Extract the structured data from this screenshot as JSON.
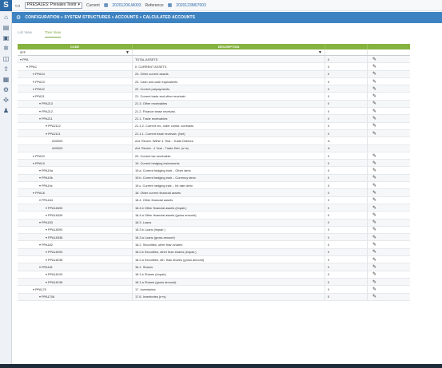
{
  "rail": {
    "logo": "S",
    "icons": [
      "home-icon",
      "document-icon",
      "folder-icon",
      "settings-icon",
      "report-icon",
      "upload-icon",
      "calendar-icon",
      "gear-icon",
      "tools-icon",
      "users-icon"
    ]
  },
  "topbar": {
    "scenario": "PRESALES: Presales Testir",
    "current_label": "Current",
    "current_value": "2020120/UA003",
    "reference_label": "Reference",
    "reference_value": "2020123M07003"
  },
  "title": "CONFIGURATION » SYSTEM STRUCTURES » ACCOUNTS » CALCULATED ACCOUNTS",
  "tabs": [
    {
      "label": "List View",
      "active": false
    },
    {
      "label": "Tree View",
      "active": true
    }
  ],
  "grid": {
    "headers": {
      "code": "CODE",
      "description": "DESCRIPTION"
    },
    "filter": {
      "code": "0PF",
      "description": ""
    },
    "rows": [
      {
        "indent": 0,
        "code": "PPA",
        "desc": "TOTAL ASSETS",
        "num": "0",
        "edit": true
      },
      {
        "indent": 1,
        "code": "PPAC",
        "desc": "II. CURRENT ASSETS",
        "num": "0",
        "edit": true
      },
      {
        "indent": 2,
        "code": "PPA24",
        "desc": "24. Other current assets",
        "num": "0",
        "edit": true
      },
      {
        "indent": 2,
        "code": "PPA23",
        "desc": "23. Cash and cash equivalents",
        "num": "0",
        "edit": true
      },
      {
        "indent": 2,
        "code": "PPA22",
        "desc": "22. Current prepayments",
        "num": "0",
        "edit": true
      },
      {
        "indent": 2,
        "code": "PPA21",
        "desc": "21. Current trade and other receivab.",
        "num": "0",
        "edit": true
      },
      {
        "indent": 3,
        "code": "PPA213",
        "desc": "21.3. Other receivables",
        "num": "0",
        "edit": true
      },
      {
        "indent": 3,
        "code": "PPA212",
        "desc": "21.2. Finance lease receivab.",
        "num": "0",
        "edit": true
      },
      {
        "indent": 3,
        "code": "PPA211",
        "desc": "21.1. Trade receivables",
        "num": "0",
        "edit": true
      },
      {
        "indent": 4,
        "code": "PPA2112",
        "desc": "21.1.2. Current rec. order constr. contracts",
        "num": "0",
        "edit": true
      },
      {
        "indent": 4,
        "code": "PPA2111",
        "desc": "21.1.1. Current trade receivab. (Net)",
        "num": "0",
        "edit": true
      },
      {
        "indent": 5,
        "code": "A00000",
        "desc": "Ant. Receiv. Within 1 Year - Trade Debtors",
        "num": "A",
        "edit": false
      },
      {
        "indent": 5,
        "code": "A00000",
        "desc": "Ant. Receiv. -1 Year - Trade Deb. (s+a)",
        "num": "A",
        "edit": false
      },
      {
        "indent": 2,
        "code": "PPA20",
        "desc": "20. Current tax receivable",
        "num": "0",
        "edit": true
      },
      {
        "indent": 2,
        "code": "PPA19",
        "desc": "19. Current hedging instruments",
        "num": "0",
        "edit": true
      },
      {
        "indent": 3,
        "code": "PPA19a",
        "desc": "19.a. Current hedging instr. - Other deriv.",
        "num": "0",
        "edit": true
      },
      {
        "indent": 3,
        "code": "PPA19b",
        "desc": "19.b. Current hedging instr. - Currency deriv.",
        "num": "0",
        "edit": true
      },
      {
        "indent": 3,
        "code": "PPA19c",
        "desc": "19.c. Current hedging instr. - Int rate deriv.",
        "num": "0",
        "edit": true
      },
      {
        "indent": 2,
        "code": "PPA18",
        "desc": "18. Other current financial assets",
        "num": "0",
        "edit": true
      },
      {
        "indent": 3,
        "code": "PPA184",
        "desc": "18.4. Other financial assets",
        "num": "0",
        "edit": true
      },
      {
        "indent": 4,
        "code": "PPA18493",
        "desc": "18.4.b Other financial assets (impair.)",
        "num": "0",
        "edit": true
      },
      {
        "indent": 4,
        "code": "PPA18439",
        "desc": "18.4.a Other financial assets (gross amount)",
        "num": "0",
        "edit": true
      },
      {
        "indent": 3,
        "code": "PPA183",
        "desc": "18.3. Loans",
        "num": "0",
        "edit": true
      },
      {
        "indent": 4,
        "code": "PPA18393",
        "desc": "18.3.b Loans (impair.)",
        "num": "0",
        "edit": true
      },
      {
        "indent": 4,
        "code": "PPA18338",
        "desc": "18.3.a Loans (gross amount)",
        "num": "0",
        "edit": true
      },
      {
        "indent": 3,
        "code": "PPA182",
        "desc": "18.2. Securities, other than shares",
        "num": "0",
        "edit": true
      },
      {
        "indent": 4,
        "code": "PPA18293",
        "desc": "18.2.b Securities, other than shares (impair.)",
        "num": "0",
        "edit": true
      },
      {
        "indent": 4,
        "code": "PPA18238",
        "desc": "18.2.a Securities, oth. than shares (gross amount)",
        "num": "0",
        "edit": true
      },
      {
        "indent": 3,
        "code": "PPA181",
        "desc": "18.1. Shares",
        "num": "0",
        "edit": true
      },
      {
        "indent": 4,
        "code": "PPA18193",
        "desc": "18.1.b Shares (impair.)",
        "num": "0",
        "edit": true
      },
      {
        "indent": 4,
        "code": "PPA18138",
        "desc": "18.1.a Shares (gross amount)",
        "num": "0",
        "edit": true
      },
      {
        "indent": 2,
        "code": "PPA170",
        "desc": "17. Inventories",
        "num": "0",
        "edit": true
      },
      {
        "indent": 3,
        "code": "PPA1706",
        "desc": "17.6. Inventories (s+s)",
        "num": "0",
        "edit": true
      }
    ]
  }
}
